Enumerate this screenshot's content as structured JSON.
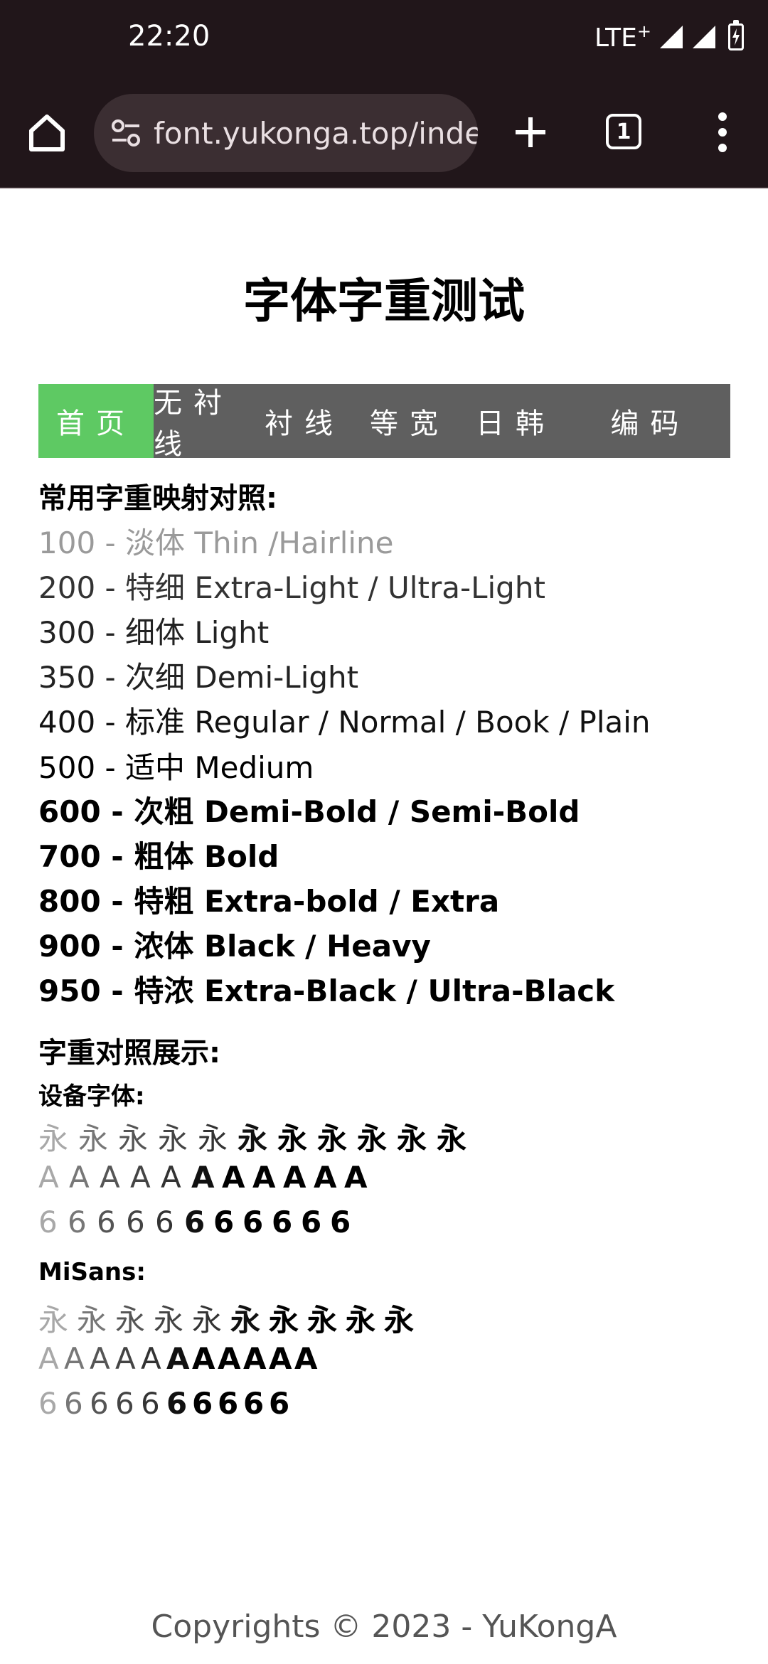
{
  "status_bar": {
    "time": "22:20",
    "network": "LTE",
    "network_sup": "+"
  },
  "browser": {
    "url": "font.yukonga.top/inde",
    "tab_count": "1"
  },
  "page": {
    "title": "字体字重测试",
    "nav": [
      {
        "label": "首页",
        "active": true
      },
      {
        "label": "无衬线",
        "active": false
      },
      {
        "label": "衬线",
        "active": false
      },
      {
        "label": "等宽",
        "active": false
      },
      {
        "label": "日韩",
        "active": false
      },
      {
        "label": "编码",
        "active": false
      }
    ],
    "mapping_title": "常用字重映射对照:",
    "weights": [
      {
        "text": "100 - 淡体 Thin /Hairline",
        "weight": 100,
        "color": "#9a9a9a"
      },
      {
        "text": "200 - 特细 Extra-Light / Ultra-Light",
        "weight": 200,
        "color": "#333333"
      },
      {
        "text": "300 - 细体 Light",
        "weight": 300,
        "color": "#222222"
      },
      {
        "text": "350 - 次细 Demi-Light",
        "weight": 350,
        "color": "#222222"
      },
      {
        "text": "400 - 标准 Regular / Normal / Book / Plain",
        "weight": 400,
        "color": "#111111"
      },
      {
        "text": "500 - 适中 Medium",
        "weight": 500,
        "color": "#000000"
      },
      {
        "text": "600 - 次粗 Demi-Bold / Semi-Bold",
        "weight": 600,
        "color": "#000000"
      },
      {
        "text": "700 - 粗体 Bold",
        "weight": 700,
        "color": "#000000"
      },
      {
        "text": "800 - 特粗 Extra-bold / Extra",
        "weight": 800,
        "color": "#000000"
      },
      {
        "text": "900 - 浓体 Black / Heavy",
        "weight": 900,
        "color": "#000000"
      },
      {
        "text": "950 - 特浓 Extra-Black / Ultra-Black",
        "weight": 950,
        "color": "#000000"
      }
    ],
    "showcase_title": "字重对照展示:",
    "device_font_label": "设备字体:",
    "misans_label": "MiSans:",
    "device_rows": [
      [
        "永",
        "永",
        "永",
        "永",
        "永",
        "永",
        "永",
        "永",
        "永",
        "永",
        "永"
      ],
      [
        "A",
        "A",
        "A",
        "A",
        "A",
        "A",
        "A",
        "A",
        "A",
        "A",
        "A"
      ],
      [
        "6",
        "6",
        "6",
        "6",
        "6",
        "6",
        "6",
        "6",
        "6",
        "6",
        "6"
      ]
    ],
    "misans_rows": [
      [
        "永",
        "永",
        "永",
        "永",
        "永",
        "永",
        "永",
        "永",
        "永",
        "永"
      ],
      [
        "A",
        "A",
        "A",
        "A",
        "A",
        "A",
        "A",
        "A",
        "A",
        "A",
        "A"
      ],
      [
        "6",
        "6",
        "6",
        "6",
        "6",
        "6",
        "6",
        "6",
        "6",
        "6"
      ]
    ],
    "footer": "Copyrights © 2023 - YuKongA"
  }
}
